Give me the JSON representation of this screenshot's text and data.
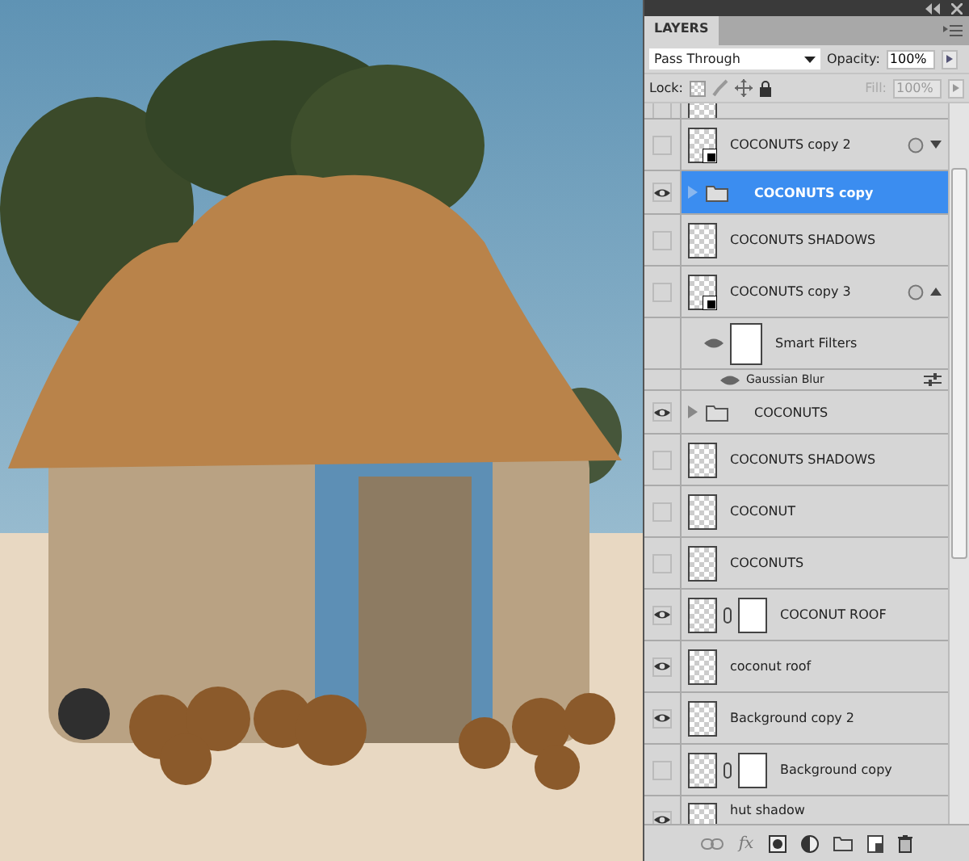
{
  "panel": {
    "tab": "LAYERS",
    "blend_mode": "Pass Through",
    "opacity_label": "Opacity:",
    "opacity": "100%",
    "lock_label": "Lock:",
    "fill_label": "Fill:",
    "fill": "100%",
    "fill_disabled": true
  },
  "layers": [
    {
      "kind": "partial",
      "visible": false,
      "selected": false
    },
    {
      "kind": "layer",
      "name": "COCONUTS copy 2",
      "visible": false,
      "selected": false,
      "smart_object": true,
      "mask": false,
      "smart_filters": {
        "expanded": false
      }
    },
    {
      "kind": "group",
      "name": "COCONUTS copy",
      "visible": true,
      "selected": true,
      "expanded": false
    },
    {
      "kind": "layer",
      "name": "COCONUTS SHADOWS",
      "visible": false,
      "selected": false,
      "smart_object": false,
      "mask": false
    },
    {
      "kind": "layer",
      "name": "COCONUTS copy 3",
      "visible": false,
      "selected": false,
      "smart_object": true,
      "mask": false,
      "smart_filters": {
        "expanded": true
      }
    },
    {
      "kind": "filters",
      "name": "Smart Filters",
      "visible": true,
      "selected": false
    },
    {
      "kind": "filter",
      "name": "Gaussian Blur",
      "visible": true,
      "selected": false
    },
    {
      "kind": "group",
      "name": "COCONUTS",
      "visible": true,
      "selected": false,
      "expanded": false
    },
    {
      "kind": "layer",
      "name": "COCONUTS SHADOWS",
      "visible": false,
      "selected": false,
      "smart_object": false,
      "mask": false
    },
    {
      "kind": "layer",
      "name": "COCONUT",
      "visible": false,
      "selected": false,
      "smart_object": false,
      "mask": false
    },
    {
      "kind": "layer",
      "name": "COCONUTS",
      "visible": false,
      "selected": false,
      "smart_object": false,
      "mask": false
    },
    {
      "kind": "layer",
      "name": "COCONUT ROOF",
      "visible": true,
      "selected": false,
      "smart_object": false,
      "mask": true
    },
    {
      "kind": "layer",
      "name": "coconut roof",
      "visible": true,
      "selected": false,
      "smart_object": false,
      "mask": false
    },
    {
      "kind": "layer",
      "name": "Background copy 2",
      "visible": true,
      "selected": false,
      "smart_object": false,
      "mask": false
    },
    {
      "kind": "layer",
      "name": "Background copy",
      "visible": false,
      "selected": false,
      "smart_object": false,
      "mask": true
    },
    {
      "kind": "cut",
      "name": "hut shadow",
      "visible": true,
      "selected": false
    }
  ],
  "footer": {
    "fx_label": "fx"
  }
}
